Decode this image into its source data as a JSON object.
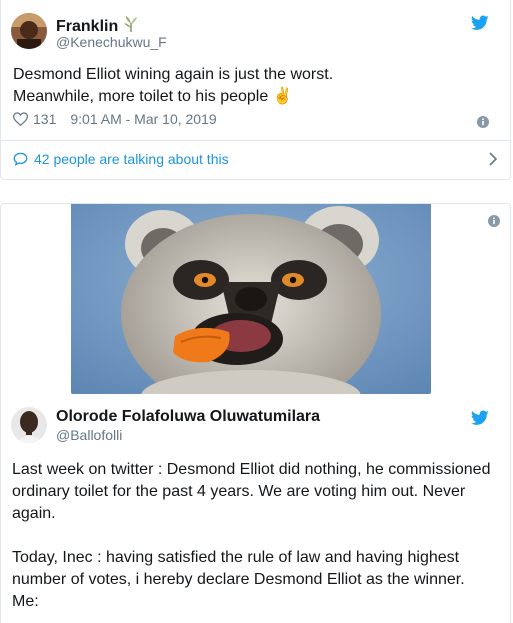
{
  "tweet1": {
    "display_name": "Franklin",
    "handle": "@Kenechukwu_F",
    "text": "Desmond Elliot wining again is just the worst.\nMeanwhile, more toilet to his people ✌️",
    "likes": "131",
    "timestamp": "9:01 AM - Mar 10, 2019",
    "talk_text": "42 people are talking about this"
  },
  "tweet2": {
    "display_name": "Olorode Folafoluwa Oluwatumilara",
    "handle": "@Ballofolli",
    "text": "Last week on twitter : Desmond Elliot did nothing, he commissioned ordinary toilet for the past 4 years. We are voting him out. Never again.\n\nToday, Inec : having satisfied the rule of law and having highest number of votes, i hereby declare Desmond Elliot as the winner.\nMe:"
  },
  "colors": {
    "twitter_blue": "#1da1f2",
    "link_blue": "#1b95e0",
    "secondary_text": "#657786",
    "border": "#e1e8ed"
  },
  "icons": [
    "avatar",
    "verified-plant-emoji",
    "twitter-bird-icon",
    "heart-icon",
    "info-icon",
    "speech-bubble-icon",
    "chevron-right-icon",
    "lemur-photo"
  ]
}
